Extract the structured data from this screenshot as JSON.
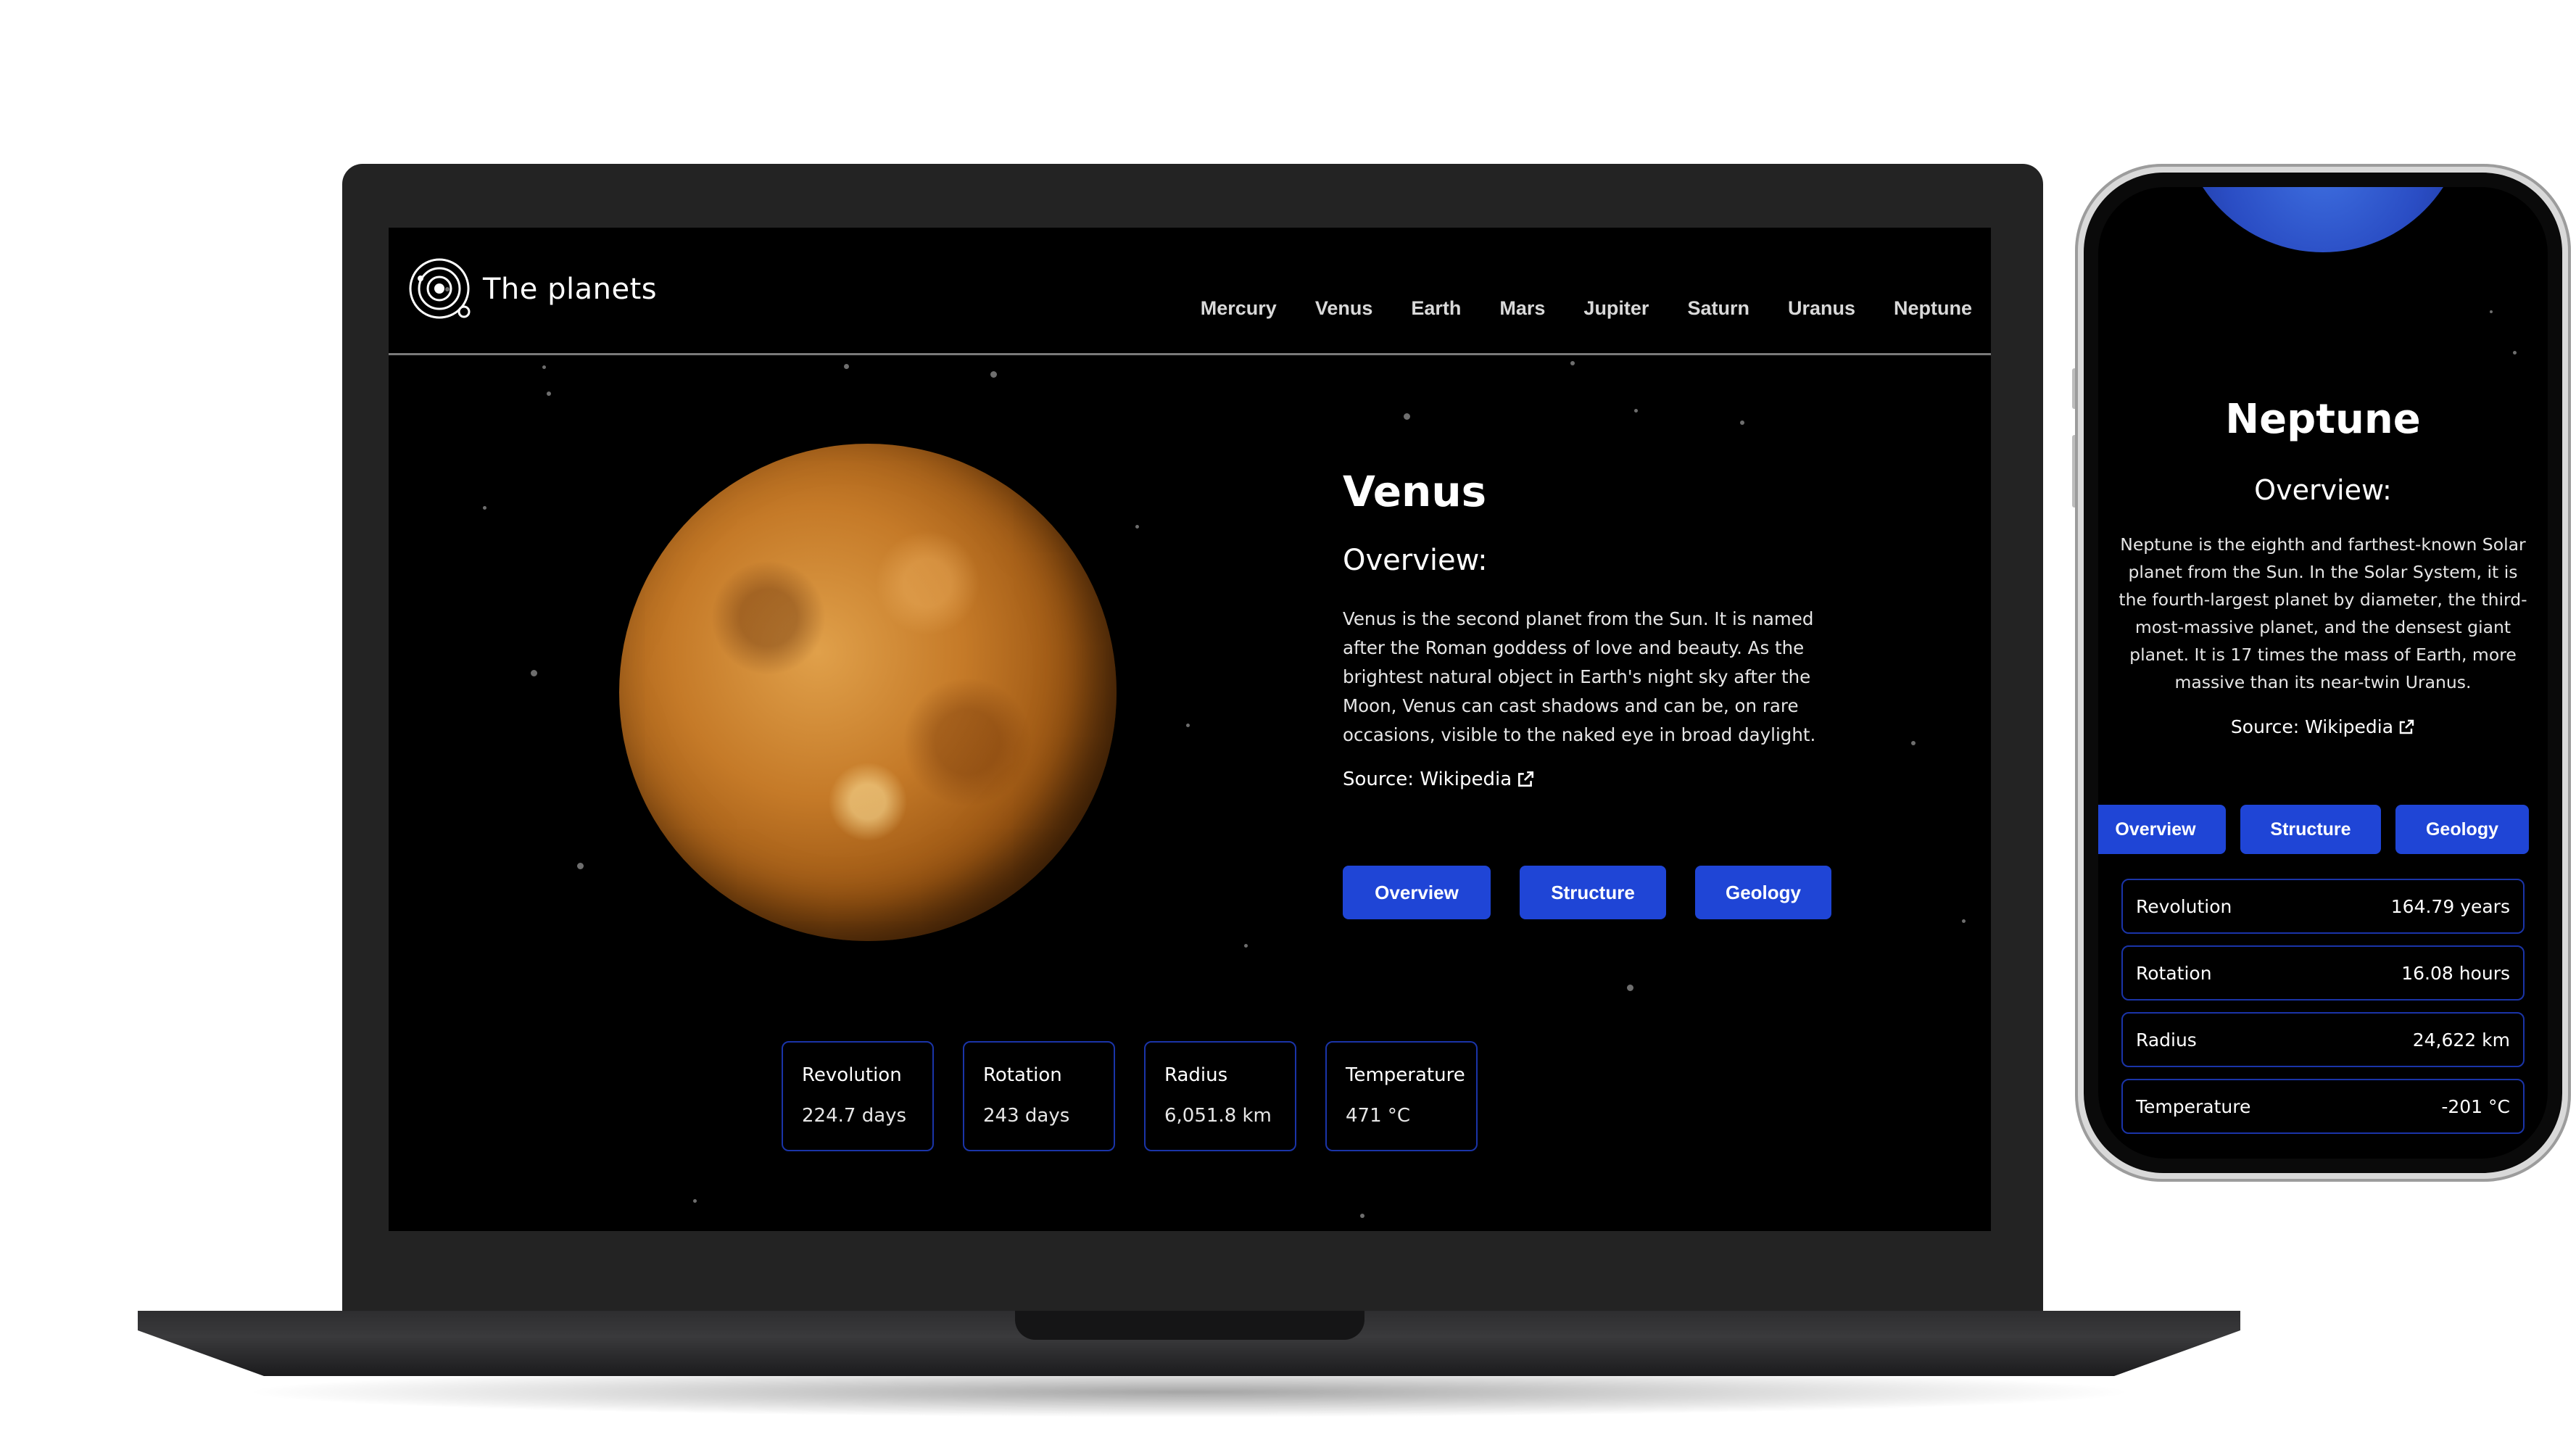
{
  "desktop": {
    "logo_text": "The planets",
    "nav": [
      "Mercury",
      "Venus",
      "Earth",
      "Mars",
      "Jupiter",
      "Saturn",
      "Uranus",
      "Neptune"
    ],
    "planet": {
      "name": "Venus",
      "overview_heading": "Overview:",
      "description": "Venus is the second planet from the Sun. It is named after the Roman goddess of love and beauty. As the brightest natural object in Earth's night sky after the Moon, Venus can cast shadows and can be, on rare occasions, visible to the naked eye in broad daylight.",
      "source_label": "Source: Wikipedia"
    },
    "tabs": [
      "Overview",
      "Structure",
      "Geology"
    ],
    "stats": [
      {
        "label": "Revolution",
        "value": "224.7 days"
      },
      {
        "label": "Rotation",
        "value": "243 days"
      },
      {
        "label": "Radius",
        "value": "6,051.8 km"
      },
      {
        "label": "Temperature",
        "value": "471 °C"
      }
    ]
  },
  "mobile": {
    "planet": {
      "name": "Neptune",
      "overview_heading": "Overview:",
      "description": "Neptune is the eighth and farthest-known Solar planet from the Sun. In the Solar System, it is the fourth-largest planet by diameter, the third-most-massive planet, and the densest giant planet. It is 17 times the mass of Earth, more massive than its near-twin Uranus.",
      "source_label": "Source: Wikipedia"
    },
    "tabs": [
      "Overview",
      "Structure",
      "Geology"
    ],
    "stats": [
      {
        "label": "Revolution",
        "value": "164.79 years"
      },
      {
        "label": "Rotation",
        "value": "16.08 hours"
      },
      {
        "label": "Radius",
        "value": "24,622 km"
      },
      {
        "label": "Temperature",
        "value": "-201 °C"
      }
    ]
  },
  "colors": {
    "accent": "#1f45d6",
    "card_border": "#1a34a8",
    "screen_bg": "#000000"
  },
  "icons": {
    "logo": "solar-system-icon",
    "source_link": "external-link-icon"
  }
}
